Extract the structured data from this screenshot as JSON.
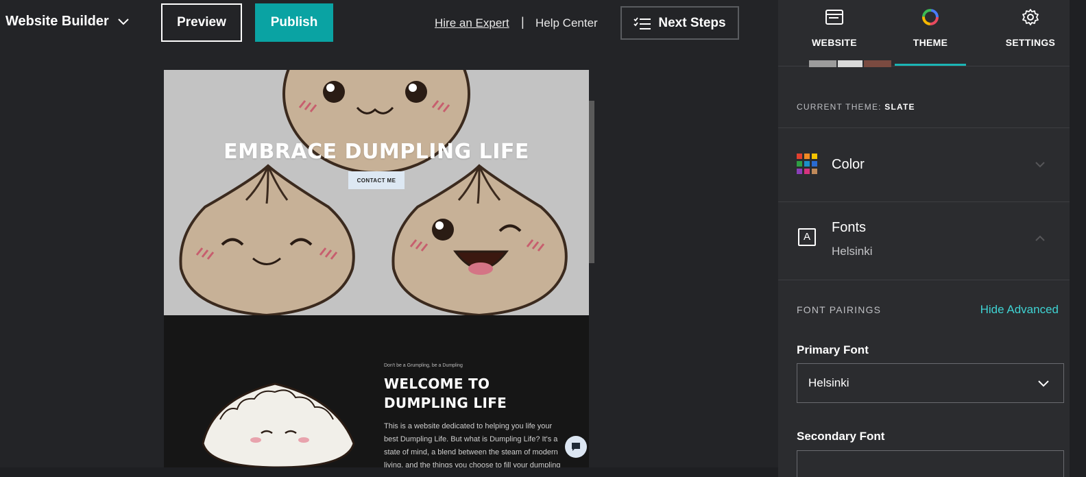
{
  "topbar": {
    "brand": "Website Builder",
    "preview_label": "Preview",
    "publish_label": "Publish",
    "hire_label": "Hire an Expert",
    "separator": "|",
    "help_label": "Help Center",
    "next_steps_label": "Next Steps"
  },
  "canvas": {
    "hero_title": "EMBRACE DUMPLING LIFE",
    "hero_cta": "CONTACT ME",
    "section_subtitle": "Don't be a Grumpling, be a Dumpling",
    "section_title": "WELCOME TO DUMPLING LIFE",
    "section_body": "This is a website dedicated to helping you life your best Dumpling Life. But what is Dumpling Life? It's a state of mind, a blend between the steam of modern living, and the things you choose to fill your dumpling"
  },
  "panel": {
    "tabs": [
      {
        "label": "WEBSITE",
        "icon": "browser-window-icon"
      },
      {
        "label": "THEME",
        "icon": "color-wheel-icon"
      },
      {
        "label": "SETTINGS",
        "icon": "gear-icon"
      }
    ],
    "active_tab": "THEME",
    "current_theme_prefix": "CURRENT THEME:",
    "current_theme_name": "SLATE",
    "color_row_label": "Color",
    "fonts_row_label": "Fonts",
    "fonts_row_value": "Helsinki",
    "font_pairings_label": "FONT PAIRINGS",
    "hide_advanced_label": "Hide Advanced",
    "primary_font_label": "Primary Font",
    "primary_font_value": "Helsinki",
    "secondary_font_label": "Secondary Font"
  },
  "colors": {
    "accent": "#0aa3a3",
    "link_accent": "#3fd3d3",
    "panel_bg": "#2b2c2f",
    "app_bg": "#232427"
  }
}
